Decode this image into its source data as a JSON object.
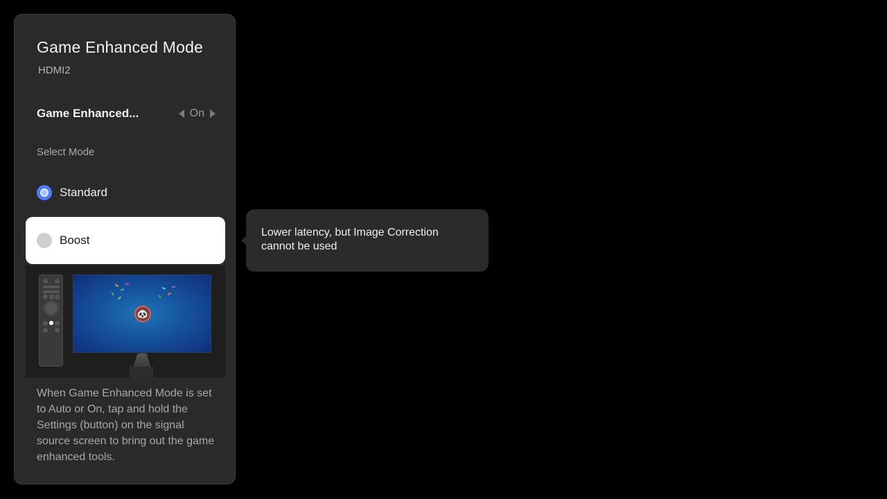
{
  "panel": {
    "title": "Game Enhanced Mode",
    "subtitle": "HDMI2",
    "setting": {
      "label": "Game Enhanced...",
      "value": "On"
    },
    "section_label": "Select Mode",
    "modes": [
      {
        "label": "Standard",
        "selected": true
      },
      {
        "label": "Boost",
        "selected": false,
        "focused": true
      }
    ],
    "description": "When Game Enhanced Mode is set to Auto or On, tap and hold the Settings (button) on the signal source screen to bring out the game enhanced tools."
  },
  "tooltip": {
    "text": "Lower latency, but Image Correction cannot be used"
  },
  "colors": {
    "background": "#000000",
    "panel": "#2a2a2a",
    "accent": "#4f7bf4",
    "focus_row": "#ffffff"
  },
  "icons": {
    "prev": "chevron-left-icon",
    "next": "chevron-right-icon",
    "illustration": "remote-and-tv-illustration"
  }
}
